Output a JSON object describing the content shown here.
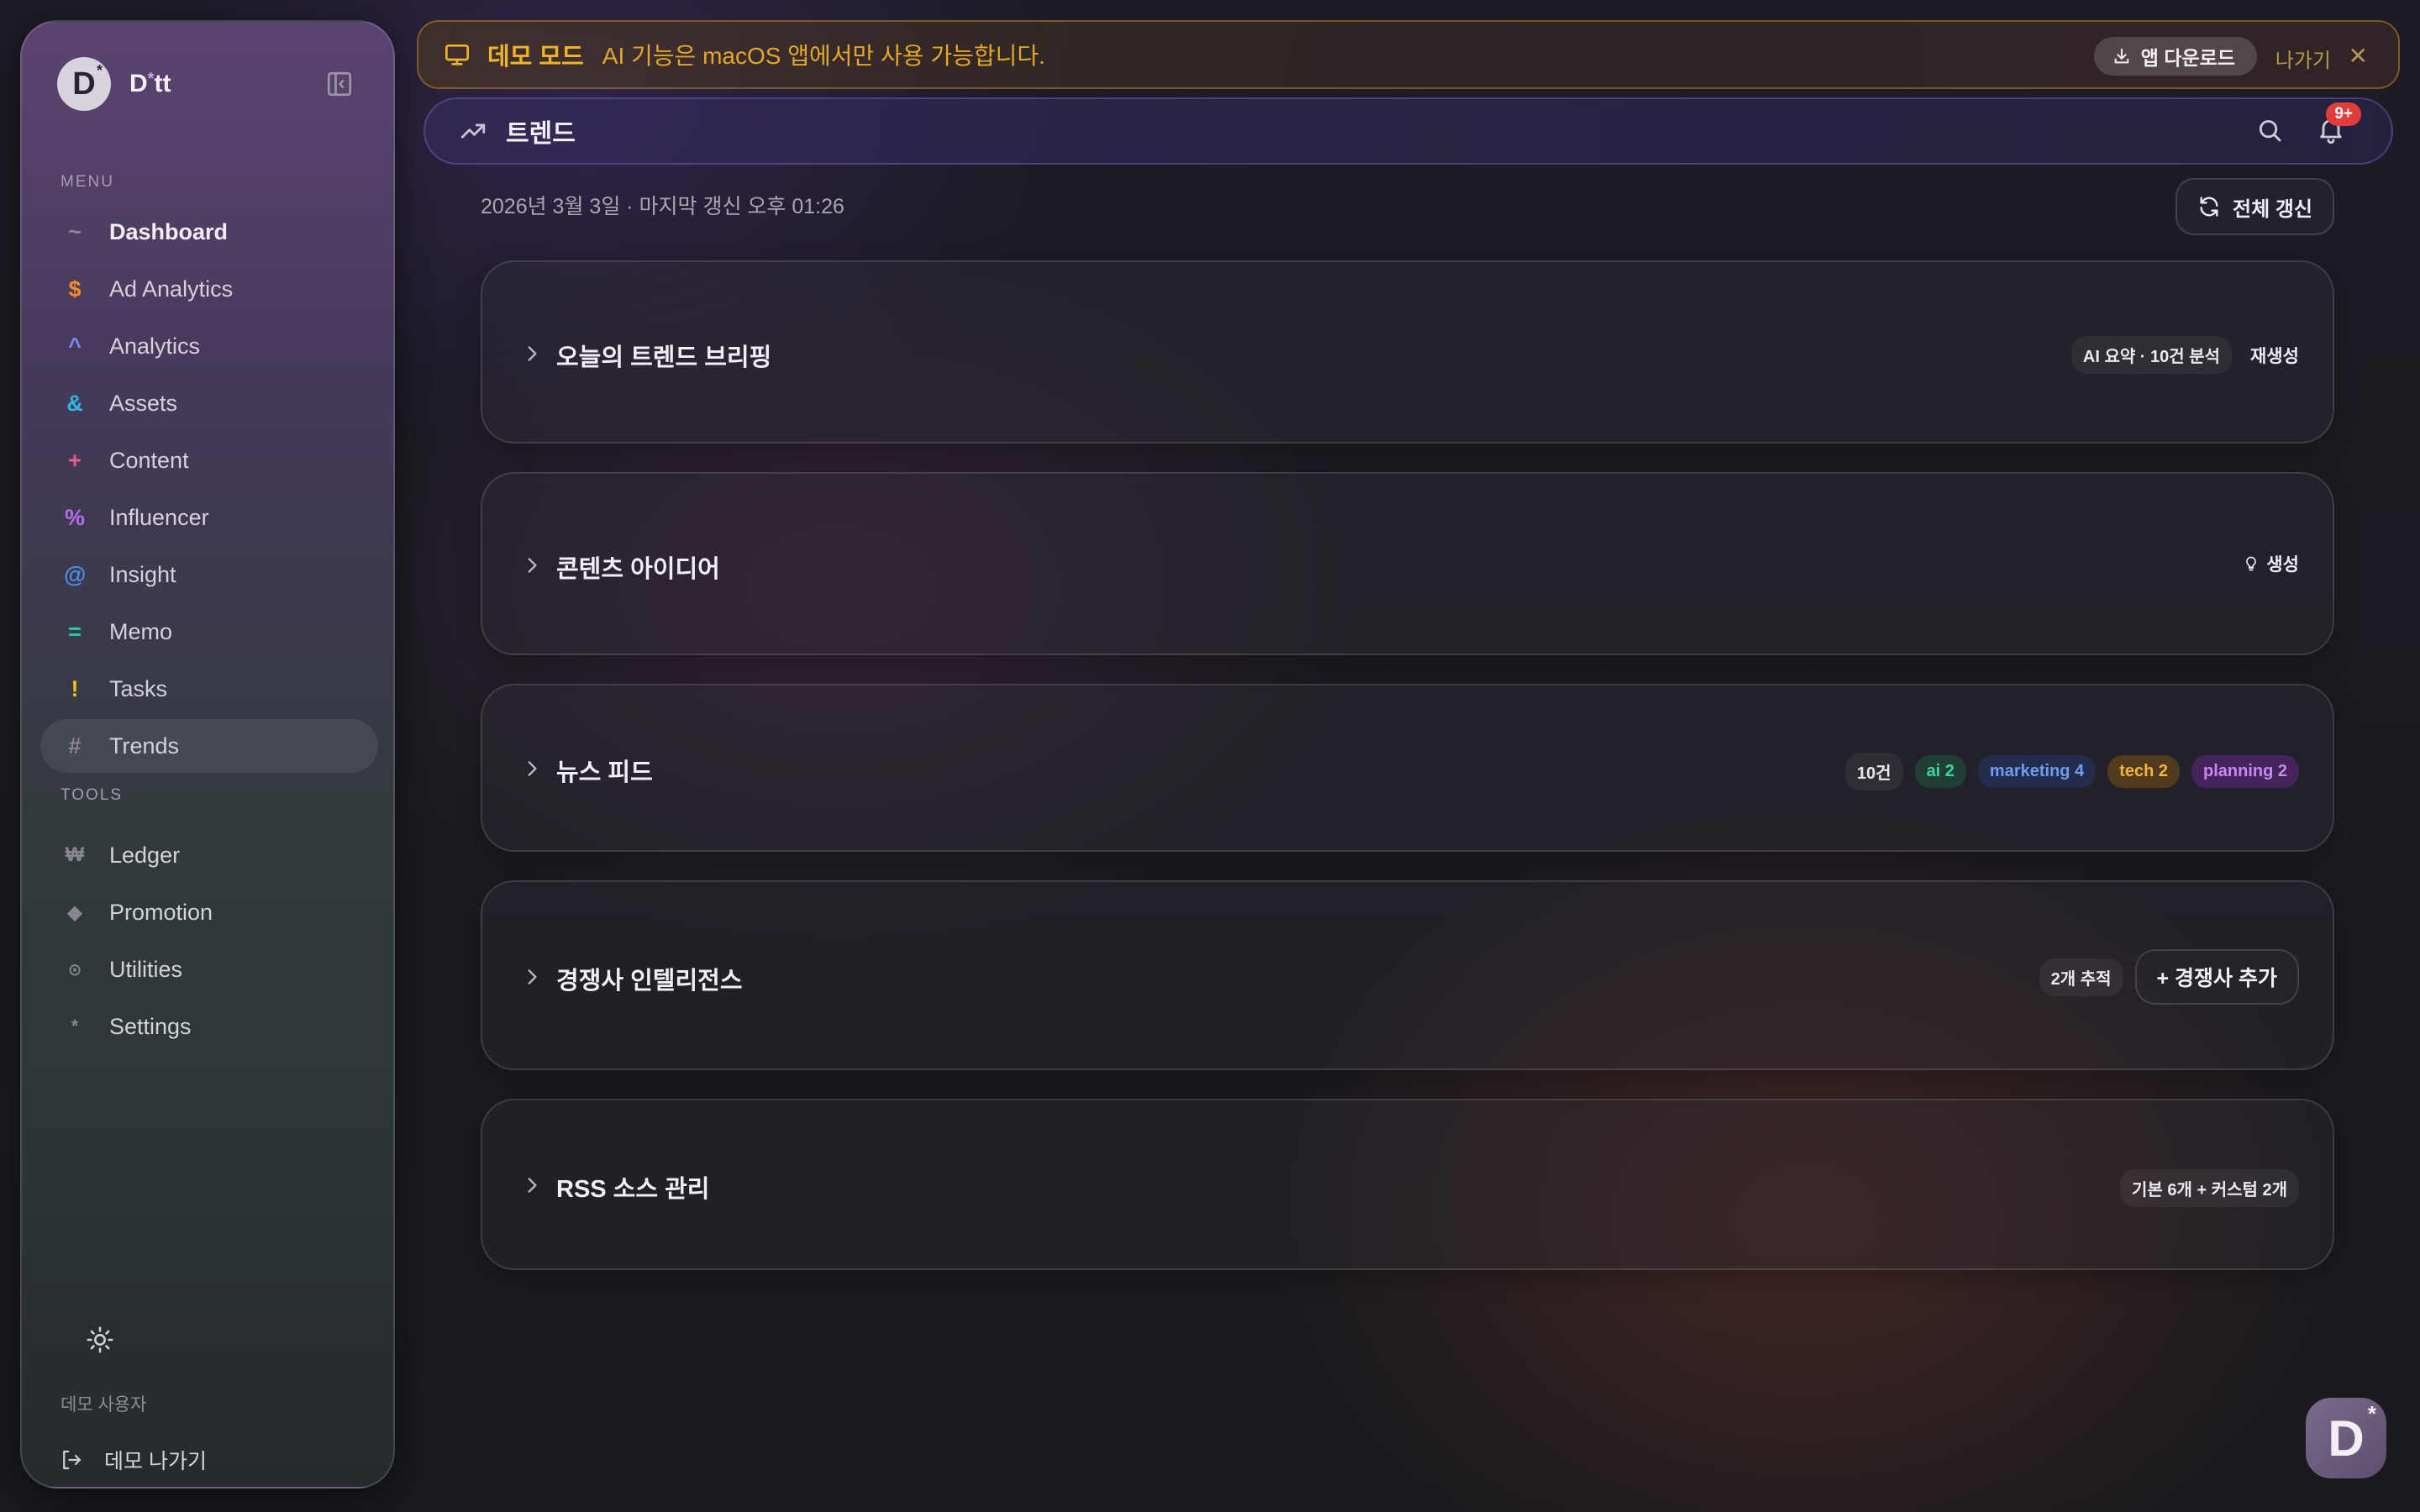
{
  "sidebar": {
    "brand": {
      "logo_letter": "D",
      "logo_star": "*",
      "name_prefix": "D",
      "name_asterisk": "*",
      "name_suffix": "tt"
    },
    "menu_label": "MENU",
    "menu_items": [
      {
        "glyph": "~",
        "label": "Dashboard",
        "color": "#8f8896"
      },
      {
        "glyph": "$",
        "label": "Ad Analytics",
        "color": "#f28b2b"
      },
      {
        "glyph": "^",
        "label": "Analytics",
        "color": "#7b86f2"
      },
      {
        "glyph": "&",
        "label": "Assets",
        "color": "#2fb7e8"
      },
      {
        "glyph": "+",
        "label": "Content",
        "color": "#f05a8e"
      },
      {
        "glyph": "%",
        "label": "Influencer",
        "color": "#b06ef2"
      },
      {
        "glyph": "@",
        "label": "Insight",
        "color": "#4a8ff2"
      },
      {
        "glyph": "=",
        "label": "Memo",
        "color": "#26c9a6"
      },
      {
        "glyph": "!",
        "label": "Tasks",
        "color": "#f2c21e"
      },
      {
        "glyph": "#",
        "label": "Trends",
        "color": "#8a8590"
      }
    ],
    "tools_label": "TOOLS",
    "tool_items": [
      {
        "glyph": "₩",
        "label": "Ledger",
        "color": "#8a8590"
      },
      {
        "glyph": "◆",
        "label": "Promotion",
        "color": "#8a8590"
      },
      {
        "glyph": "⊙",
        "label": "Utilities",
        "color": "#8a8590"
      },
      {
        "glyph": "*",
        "label": "Settings",
        "color": "#8a8590"
      }
    ],
    "user_label": "데모 사용자",
    "logout_label": "데모 나가기"
  },
  "banner": {
    "title": "데모 모드",
    "message": "AI 기능은 macOS 앱에서만 사용 가능합니다.",
    "download_label": "앱 다운로드",
    "exit_label": "나가기",
    "close_glyph": "✕"
  },
  "header": {
    "title": "트렌드",
    "notification_badge": "9+"
  },
  "date_line": "2026년 3월 3일 · 마지막 갱신 오후 01:26",
  "refresh_label": "전체 갱신",
  "cards": {
    "briefing": {
      "title": "오늘의 트렌드 브리핑",
      "badge": "AI 요약 · 10건 분석",
      "action": "재생성"
    },
    "ideas": {
      "title": "콘텐츠 아이디어",
      "action": "생성"
    },
    "news": {
      "title": "뉴스 피드",
      "pills": [
        "10건",
        "ai 2",
        "marketing 4",
        "tech 2",
        "planning 2"
      ]
    },
    "competitor": {
      "title": "경쟁사 인텔리전스",
      "badge": "2개 추적",
      "action": "+ 경쟁사 추가"
    },
    "rss": {
      "title": "RSS 소스 관리",
      "badge": "기본 6개 + 커스텀 2개"
    }
  },
  "corner_logo": {
    "letter": "D",
    "star": "*"
  },
  "colors": {
    "accent_warning": "#f2b326",
    "badge_red": "#e23d3d"
  }
}
